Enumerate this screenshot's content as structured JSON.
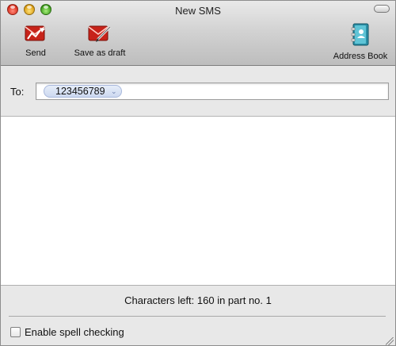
{
  "window": {
    "title": "New SMS"
  },
  "toolbar": {
    "send_label": "Send",
    "save_draft_label": "Save as draft",
    "address_book_label": "Address Book",
    "icons": {
      "send": "send-sms-icon",
      "draft": "save-draft-icon",
      "book": "address-book-icon"
    }
  },
  "recipient": {
    "label": "To:",
    "tokens": [
      "123456789"
    ]
  },
  "message": {
    "value": ""
  },
  "status": {
    "chars_left": "Characters left: 160 in part no. 1"
  },
  "spellcheck": {
    "label": "Enable spell checking",
    "checked": false
  },
  "colors": {
    "icon_red": "#c7231a",
    "icon_teal": "#2a8fa6",
    "token_fill": "#dbe4f5"
  }
}
